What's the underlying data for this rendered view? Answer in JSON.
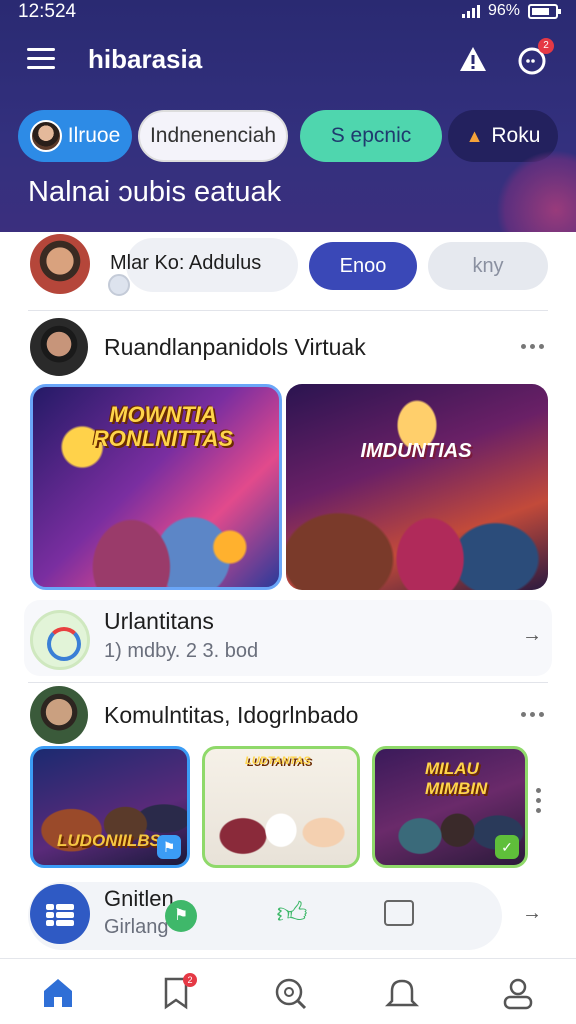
{
  "status_bar": {
    "time": "12:524",
    "battery": "96%"
  },
  "header": {
    "title": "hibarasia",
    "notification_count": "2"
  },
  "chips": [
    {
      "label": "Ilruoe",
      "active": true
    },
    {
      "label": "Indnenenciah"
    },
    {
      "label": "S epcnic"
    },
    {
      "label": "Roku"
    }
  ],
  "section_heading": "Nalnai ɔubis eatuak",
  "comment_row": {
    "input_text": "Mlar Ko: Addulus",
    "primary_button": "Enoo",
    "secondary_button": "kny"
  },
  "post_1": {
    "title": "Ruandlanpanidols Virtuak",
    "media": [
      {
        "caption": "MOWNTIA RONLNITTAS"
      },
      {
        "caption": "IMDUNTIAS"
      }
    ]
  },
  "info_card": {
    "title": "Urlantitans",
    "subtitle": "1) mdby. 2 3. bod"
  },
  "post_2": {
    "title": "Komulntitas, Idogrlnbado",
    "thumbnails": [
      {
        "caption": "LUDONIILBS"
      },
      {
        "caption": "LUDTANTAS"
      },
      {
        "caption": "MILAU MIMBIN"
      }
    ]
  },
  "group_row": {
    "title": "Gnitlen",
    "subtitle": "Girlang"
  },
  "colors": {
    "header_bg": "#2a2a72",
    "accent_blue": "#3a48b7",
    "chip_active": "#2d8be6",
    "chip_teal": "#4fd6ae",
    "chip_dark": "#23215e",
    "badge_red": "#e53945",
    "nav_active": "#2f6fd6"
  },
  "bottom_nav": {
    "items": [
      "home-icon",
      "bookmark-icon",
      "search-icon",
      "bell-icon",
      "profile-icon"
    ],
    "saved_badge": "2"
  }
}
